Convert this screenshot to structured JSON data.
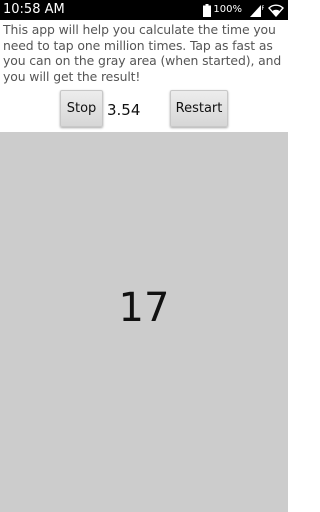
{
  "status_bar": {
    "time": "10:58 AM",
    "battery_percent": "100%",
    "icons": [
      "battery-icon",
      "signal-icon",
      "wifi-icon"
    ]
  },
  "description": "This app will help you calculate the time you need to tap one million times. Tap as fast as you can on the gray area (when started), and you will get the result!",
  "controls": {
    "stop_label": "Stop",
    "elapsed_time": "3.54",
    "restart_label": "Restart"
  },
  "tap_area": {
    "count": "17",
    "color": "#cccccc"
  }
}
